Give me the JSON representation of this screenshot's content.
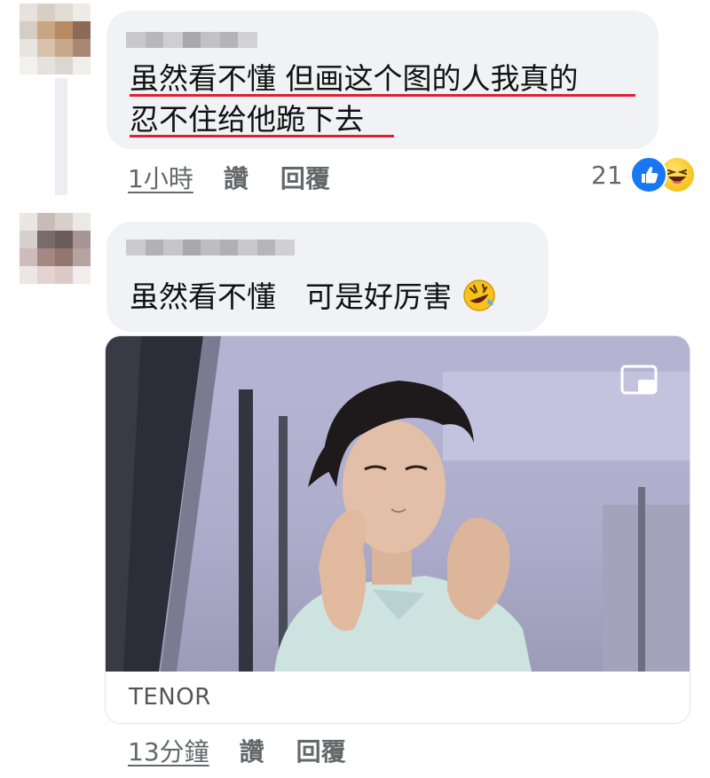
{
  "comments": [
    {
      "text_line1": "虽然看不懂 但画这个图的人我真的",
      "text_line2": "忍不住给他跪下去",
      "time": "1小時",
      "like_label": "讚",
      "reply_label": "回覆",
      "reaction_count": "21",
      "reaction_icons": [
        "like-icon",
        "laughing-emoji-icon"
      ]
    },
    {
      "text": "虽然看不懂　可是好厉害",
      "text_emoji": "rolling-on-floor-laughing-emoji",
      "gif_source": "TENOR",
      "time": "13分鐘",
      "like_label": "讚",
      "reply_label": "回覆"
    }
  ],
  "colors": {
    "bubble": "#f0f2f5",
    "underline": "#e02030",
    "like_blue": "#1877f2",
    "meta_text": "#65676b"
  }
}
